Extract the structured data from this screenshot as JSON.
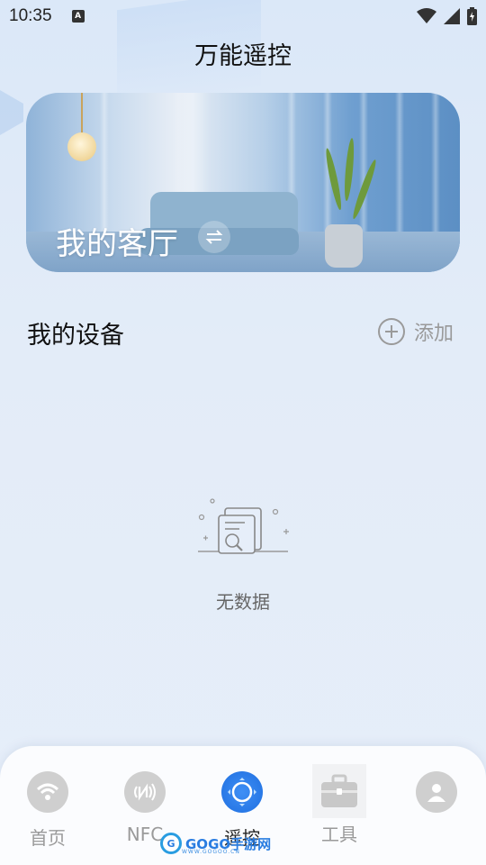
{
  "status_bar": {
    "time": "10:35",
    "notification_icon": "A"
  },
  "page": {
    "title": "万能遥控"
  },
  "room_card": {
    "name": "我的客厅",
    "switch_icon": "swap-icon"
  },
  "devices": {
    "title": "我的设备",
    "add_label": "添加",
    "empty_text": "无数据"
  },
  "nav": {
    "items": [
      {
        "label": "首页",
        "icon": "wifi-icon"
      },
      {
        "label": "NFC",
        "icon": "nfc-icon"
      },
      {
        "label": "遥控",
        "icon": "remote-icon"
      },
      {
        "label": "工具",
        "icon": "toolbox-icon"
      },
      {
        "label": "",
        "icon": "user-icon"
      }
    ],
    "active_index": 2
  },
  "watermark": {
    "text": "GOGO手游网",
    "sub": "WWW.GOGOO.CN"
  },
  "colors": {
    "accent": "#1f6fe0",
    "background": "#e3ecf8"
  }
}
